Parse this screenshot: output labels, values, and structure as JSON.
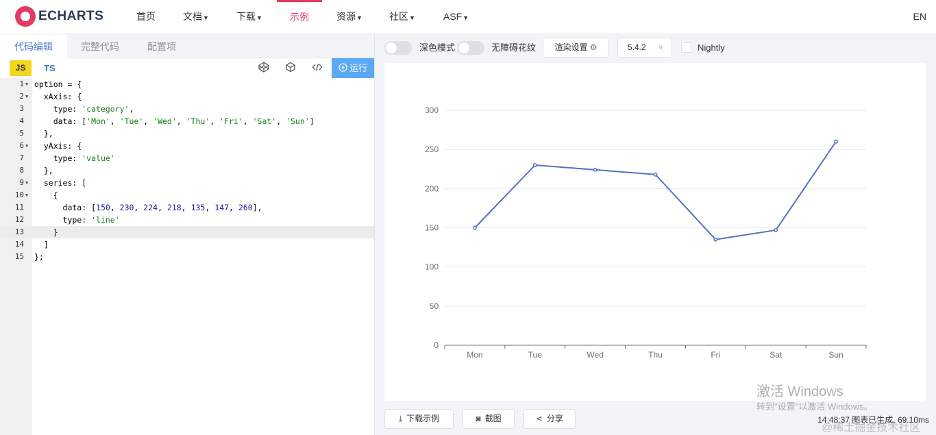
{
  "nav": {
    "logo_text": "ECHARTS",
    "items": [
      {
        "label": "首页",
        "dropdown": false
      },
      {
        "label": "文档",
        "dropdown": true
      },
      {
        "label": "下载",
        "dropdown": true
      },
      {
        "label": "示例",
        "dropdown": false,
        "active": true
      },
      {
        "label": "资源",
        "dropdown": true
      },
      {
        "label": "社区",
        "dropdown": true
      },
      {
        "label": "ASF",
        "dropdown": true
      }
    ],
    "lang": "EN"
  },
  "editor": {
    "tabs": [
      "代码编辑",
      "完整代码",
      "配置项"
    ],
    "js_label": "JS",
    "ts_label": "TS",
    "run_label": "运行",
    "lines": [
      "option = {",
      "  xAxis: {",
      "    type: 'category',",
      "    data: ['Mon', 'Tue', 'Wed', 'Thu', 'Fri', 'Sat', 'Sun']",
      "  },",
      "  yAxis: {",
      "    type: 'value'",
      "  },",
      "  series: [",
      "    {",
      "      data: [150, 230, 224, 218, 135, 147, 260],",
      "      type: 'line'",
      "    }",
      "  ]",
      "};"
    ],
    "highlighted_line": 13
  },
  "options": {
    "dark_mode_label": "深色模式",
    "a11y_label": "无障碍花纹",
    "render_label": "渲染设置",
    "version": "5.4.2",
    "nightly_label": "Nightly"
  },
  "chart_data": {
    "type": "line",
    "categories": [
      "Mon",
      "Tue",
      "Wed",
      "Thu",
      "Fri",
      "Sat",
      "Sun"
    ],
    "values": [
      150,
      230,
      224,
      218,
      135,
      147,
      260
    ],
    "ylim": [
      0,
      300
    ],
    "yticks": [
      0,
      50,
      100,
      150,
      200,
      250,
      300
    ],
    "line_color": "#5470c6",
    "grid": true
  },
  "footer": {
    "download_label": "下载示例",
    "screenshot_label": "截图",
    "share_label": "分享",
    "status": "14:48:37  图表已生成, 69.10ms"
  },
  "watermark": {
    "line1": "激活 Windows",
    "line2": "转到\"设置\"以激活 Windows。",
    "line3": "@稀土掘金技术社区"
  },
  "colors": {
    "brand": "#e43961",
    "accent": "#4e7bd9",
    "run_button": "#5aa9f7",
    "js_badge": "#f4d61c"
  }
}
